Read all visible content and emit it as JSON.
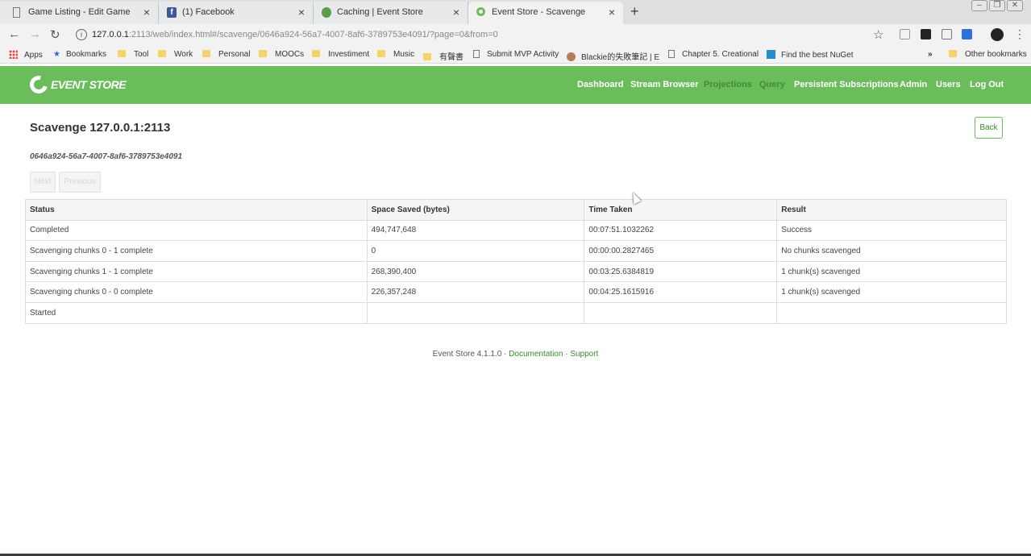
{
  "browser": {
    "tabs": [
      {
        "title": "Game Listing - Edit Game",
        "icon": "page-icon",
        "active": false
      },
      {
        "title": "(1) Facebook",
        "icon": "facebook-icon",
        "active": false
      },
      {
        "title": "Caching | Event Store",
        "icon": "eventstore-icon",
        "active": false
      },
      {
        "title": "Event Store - Scavenge",
        "icon": "eventstore-icon",
        "active": true
      }
    ],
    "url_host": "127.0.0.1",
    "url_rest": ":2113/web/index.html#/scavenge/0646a924-56a7-4007-8af6-3789753e4091/?page=0&from=0",
    "bookmarks": [
      "Apps",
      "Bookmarks",
      "Tool",
      "Work",
      "Personal",
      "MOOCs",
      "Investiment",
      "Music",
      "有聲書",
      "Submit MVP Activity",
      "Blackie的失敗筆記 | E",
      "Chapter 5. Creational",
      "Find the best NuGet",
      "Other bookmarks"
    ],
    "bookmarks_overflow": "»"
  },
  "app": {
    "logo_text": "EVENT STORE",
    "nav": [
      "Dashboard",
      "Stream Browser",
      "Projections",
      "Query",
      "Persistent Subscriptions",
      "Admin",
      "Users",
      "Log Out"
    ]
  },
  "page": {
    "title": "Scavenge 127.0.0.1:2113",
    "back_label": "Back",
    "scavenge_id": "0646a924-56a7-4007-8af6-3789753e4091",
    "next_label": "Next",
    "previous_label": "Previous"
  },
  "table": {
    "headers": [
      "Status",
      "Space Saved (bytes)",
      "Time Taken",
      "Result"
    ],
    "rows": [
      [
        "Completed",
        "494,747,648",
        "00:07:51.1032262",
        "Success"
      ],
      [
        "Scavenging chunks 0 - 1 complete",
        "0",
        "00:00:00.2827465",
        "No chunks scavenged"
      ],
      [
        "Scavenging chunks 1 - 1 complete",
        "268,390,400",
        "00:03:25.6384819",
        "1 chunk(s) scavenged"
      ],
      [
        "Scavenging chunks 0 - 0 complete",
        "226,357,248",
        "00:04:25.1615916",
        "1 chunk(s) scavenged"
      ],
      [
        "Started",
        "",
        "",
        ""
      ]
    ]
  },
  "footer": {
    "version": "Event Store 4.1.1.0 · ",
    "doc_link": "Documentation",
    "sep": " · ",
    "support_link": "Support"
  },
  "colors": {
    "navbar": "#6bbd5b",
    "link": "#3a8a2e"
  }
}
